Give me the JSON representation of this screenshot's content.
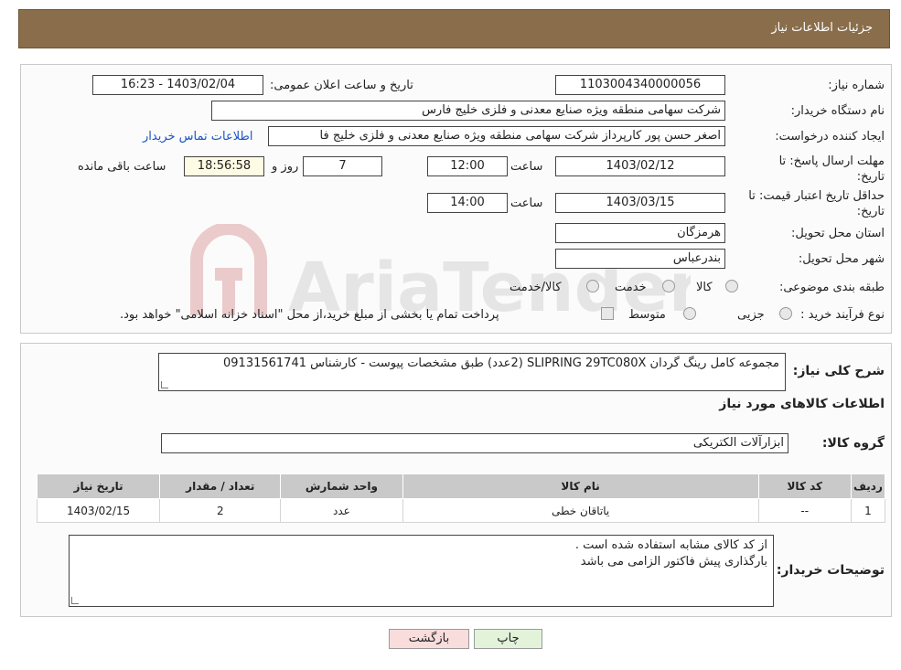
{
  "header": {
    "title": "جزئیات اطلاعات نیاز"
  },
  "labels": {
    "need_number": "شماره نیاز:",
    "announce_datetime": "تاریخ و ساعت اعلان عمومی:",
    "buyer_org": "نام دستگاه خریدار:",
    "requester": "ایجاد کننده درخواست:",
    "contact_link": "اطلاعات تماس خریدار",
    "reply_deadline": "مهلت ارسال پاسخ: تا تاریخ:",
    "price_validity": "حداقل تاریخ اعتبار قیمت: تا تاریخ:",
    "time": "ساعت",
    "day_and": "روز و",
    "remaining": "ساعت باقی مانده",
    "province": "استان محل تحویل:",
    "city": "شهر محل تحویل:",
    "category": "طبقه بندی موضوعی:",
    "process_type": "نوع فرآیند خرید :",
    "general_desc": "شرح کلی نیاز:",
    "goods_info": "اطلاعات کالاهای مورد نیاز",
    "goods_group": "گروه کالا:",
    "buyer_notes": "توضیحات خریدار:"
  },
  "values": {
    "need_number": "1103004340000056",
    "announce_datetime": "1403/02/04 - 16:23",
    "buyer_org": "شرکت سهامی منطقه ویژه صنایع معدنی و فلزی خلیج فارس",
    "requester": "اصغر حسن پور کارپرداز شرکت سهامی منطقه ویژه صنایع معدنی و فلزی خلیج فا",
    "reply_date": "1403/02/12",
    "reply_time": "12:00",
    "days": "7",
    "remaining_time": "18:56:58",
    "validity_date": "1403/03/15",
    "validity_time": "14:00",
    "province": "هرمزگان",
    "city": "بندرعباس",
    "general_desc": "مجموعه کامل رینگ گردان SLIPRING 29TC080X (2عدد) طبق مشخصات پیوست - کارشناس 09131561741",
    "goods_group": "ابزارآلات الکتریکی",
    "buyer_notes_line1": "از کد کالای مشابه استفاده شده است .",
    "buyer_notes_line2": "بارگذاری پیش فاکتور الزامی می باشد"
  },
  "category_options": [
    "کالا",
    "خدمت",
    "کالا/خدمت"
  ],
  "process_options": [
    "جزیی",
    "متوسط"
  ],
  "process_note": "پرداخت تمام یا بخشی از مبلغ خرید،از محل \"اسناد خزانه اسلامی\" خواهد بود.",
  "table": {
    "headers": [
      "ردیف",
      "کد کالا",
      "نام کالا",
      "واحد شمارش",
      "تعداد / مقدار",
      "تاریخ نیاز"
    ],
    "rows": [
      [
        "1",
        "--",
        "یاتاقان خطی",
        "عدد",
        "2",
        "1403/02/15"
      ]
    ]
  },
  "buttons": {
    "print": "چاپ",
    "back": "بازگشت"
  },
  "watermark_text": "AriaTender.neT",
  "colors": {
    "header": "#8a6d4a",
    "link": "#1a54c9",
    "back_button": "#f9dcdc",
    "print_button": "#e2f3da"
  }
}
